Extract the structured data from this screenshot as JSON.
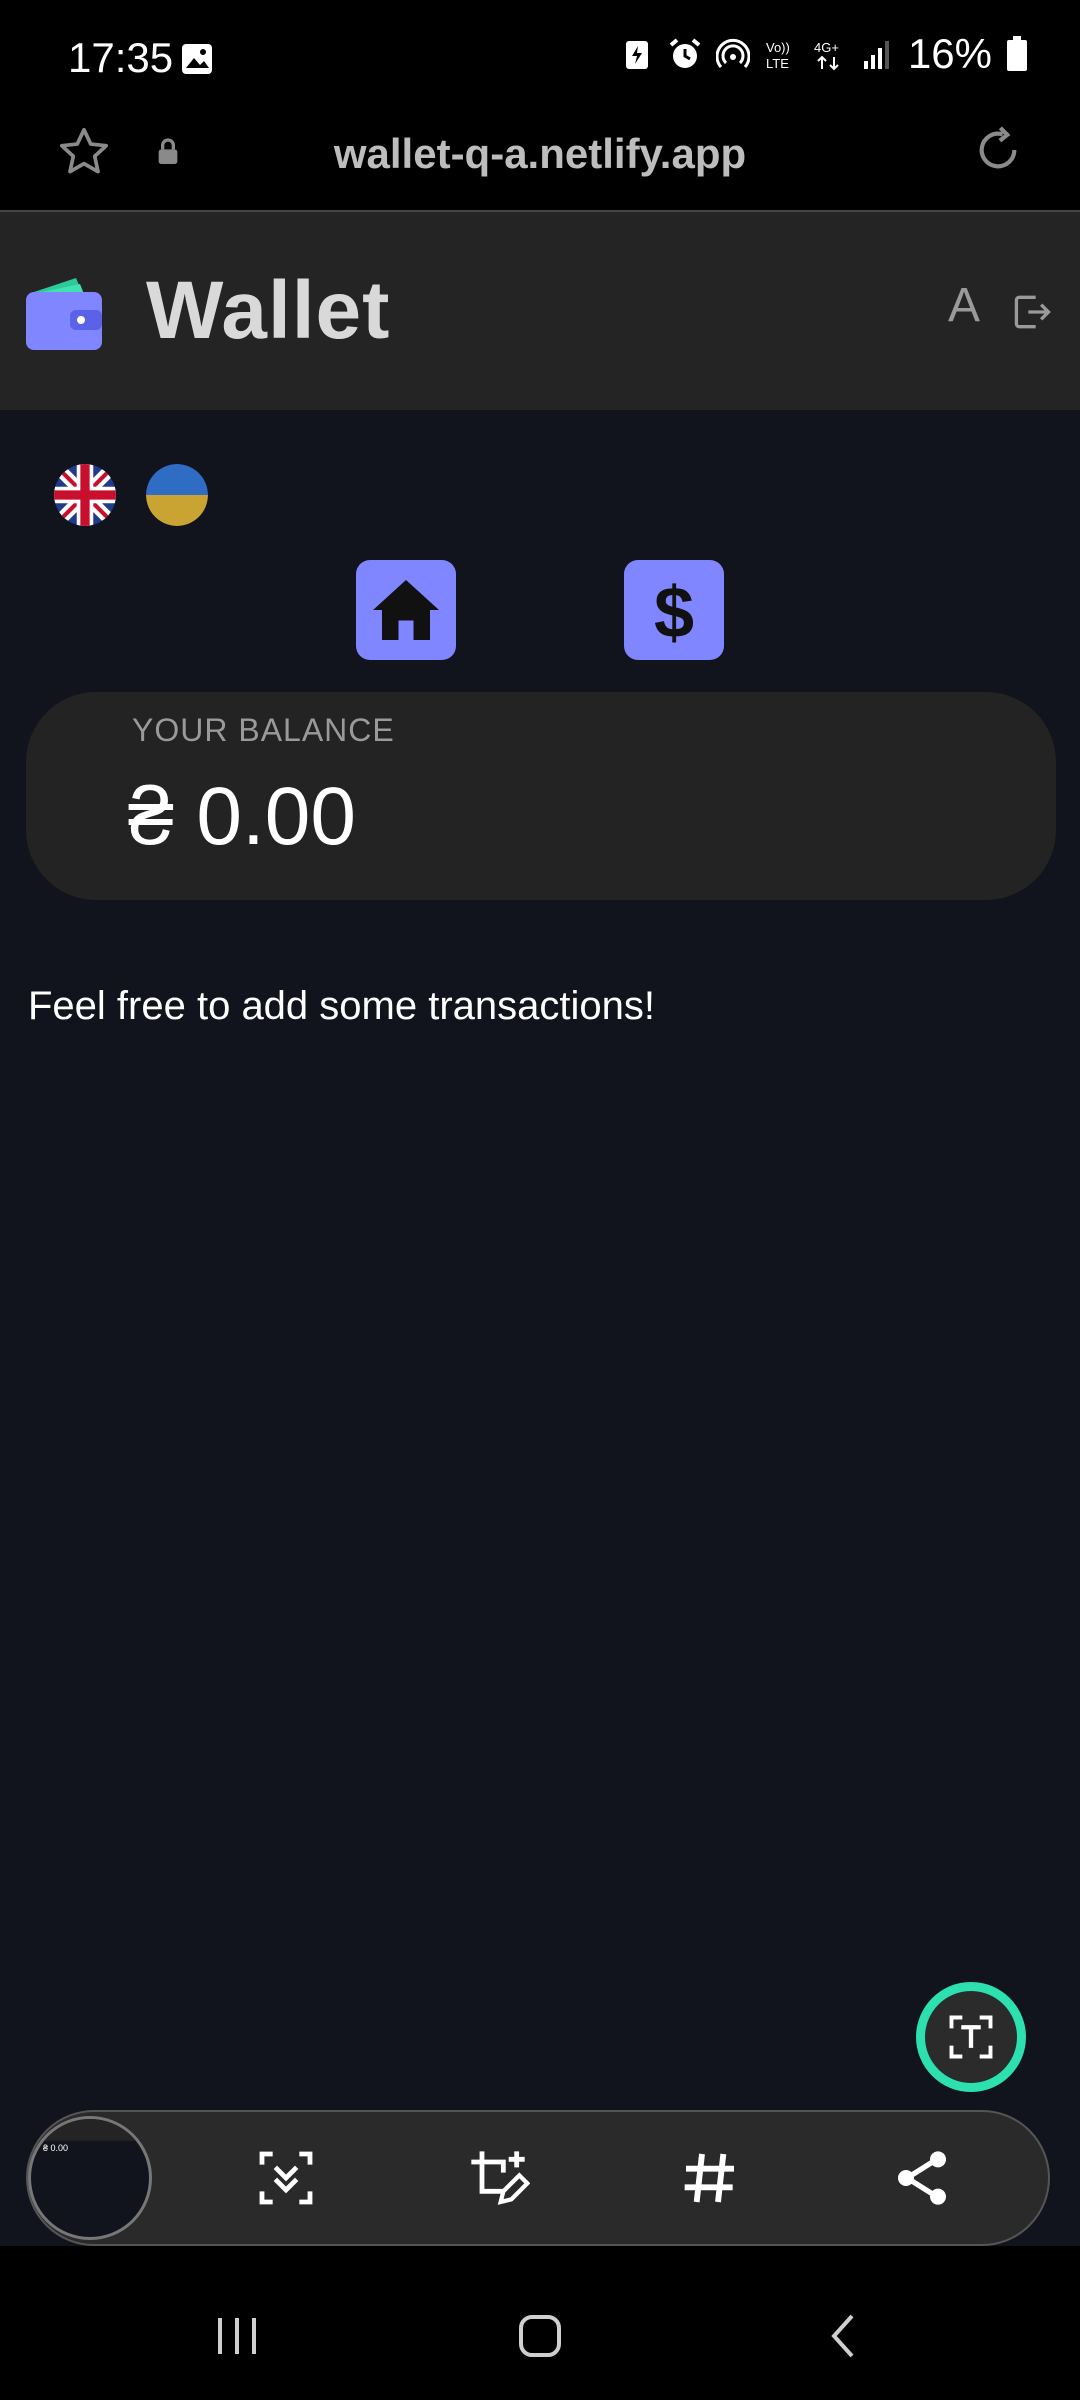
{
  "status_bar": {
    "time": "17:35",
    "battery": "16%"
  },
  "browser": {
    "url": "wallet-q-a.netlify.app"
  },
  "app": {
    "title": "Wallet",
    "lang_toggle": "A"
  },
  "balance": {
    "label": "YOUR BALANCE",
    "value": "₴ 0.00"
  },
  "empty_message": "Feel free to add some transactions!",
  "thumbnail": {
    "value": "₴ 0.00"
  },
  "colors": {
    "accent": "#7f86ff",
    "background": "#12141d",
    "header": "#242424",
    "card": "#232323",
    "fab_ring": "#2ce0b0"
  }
}
